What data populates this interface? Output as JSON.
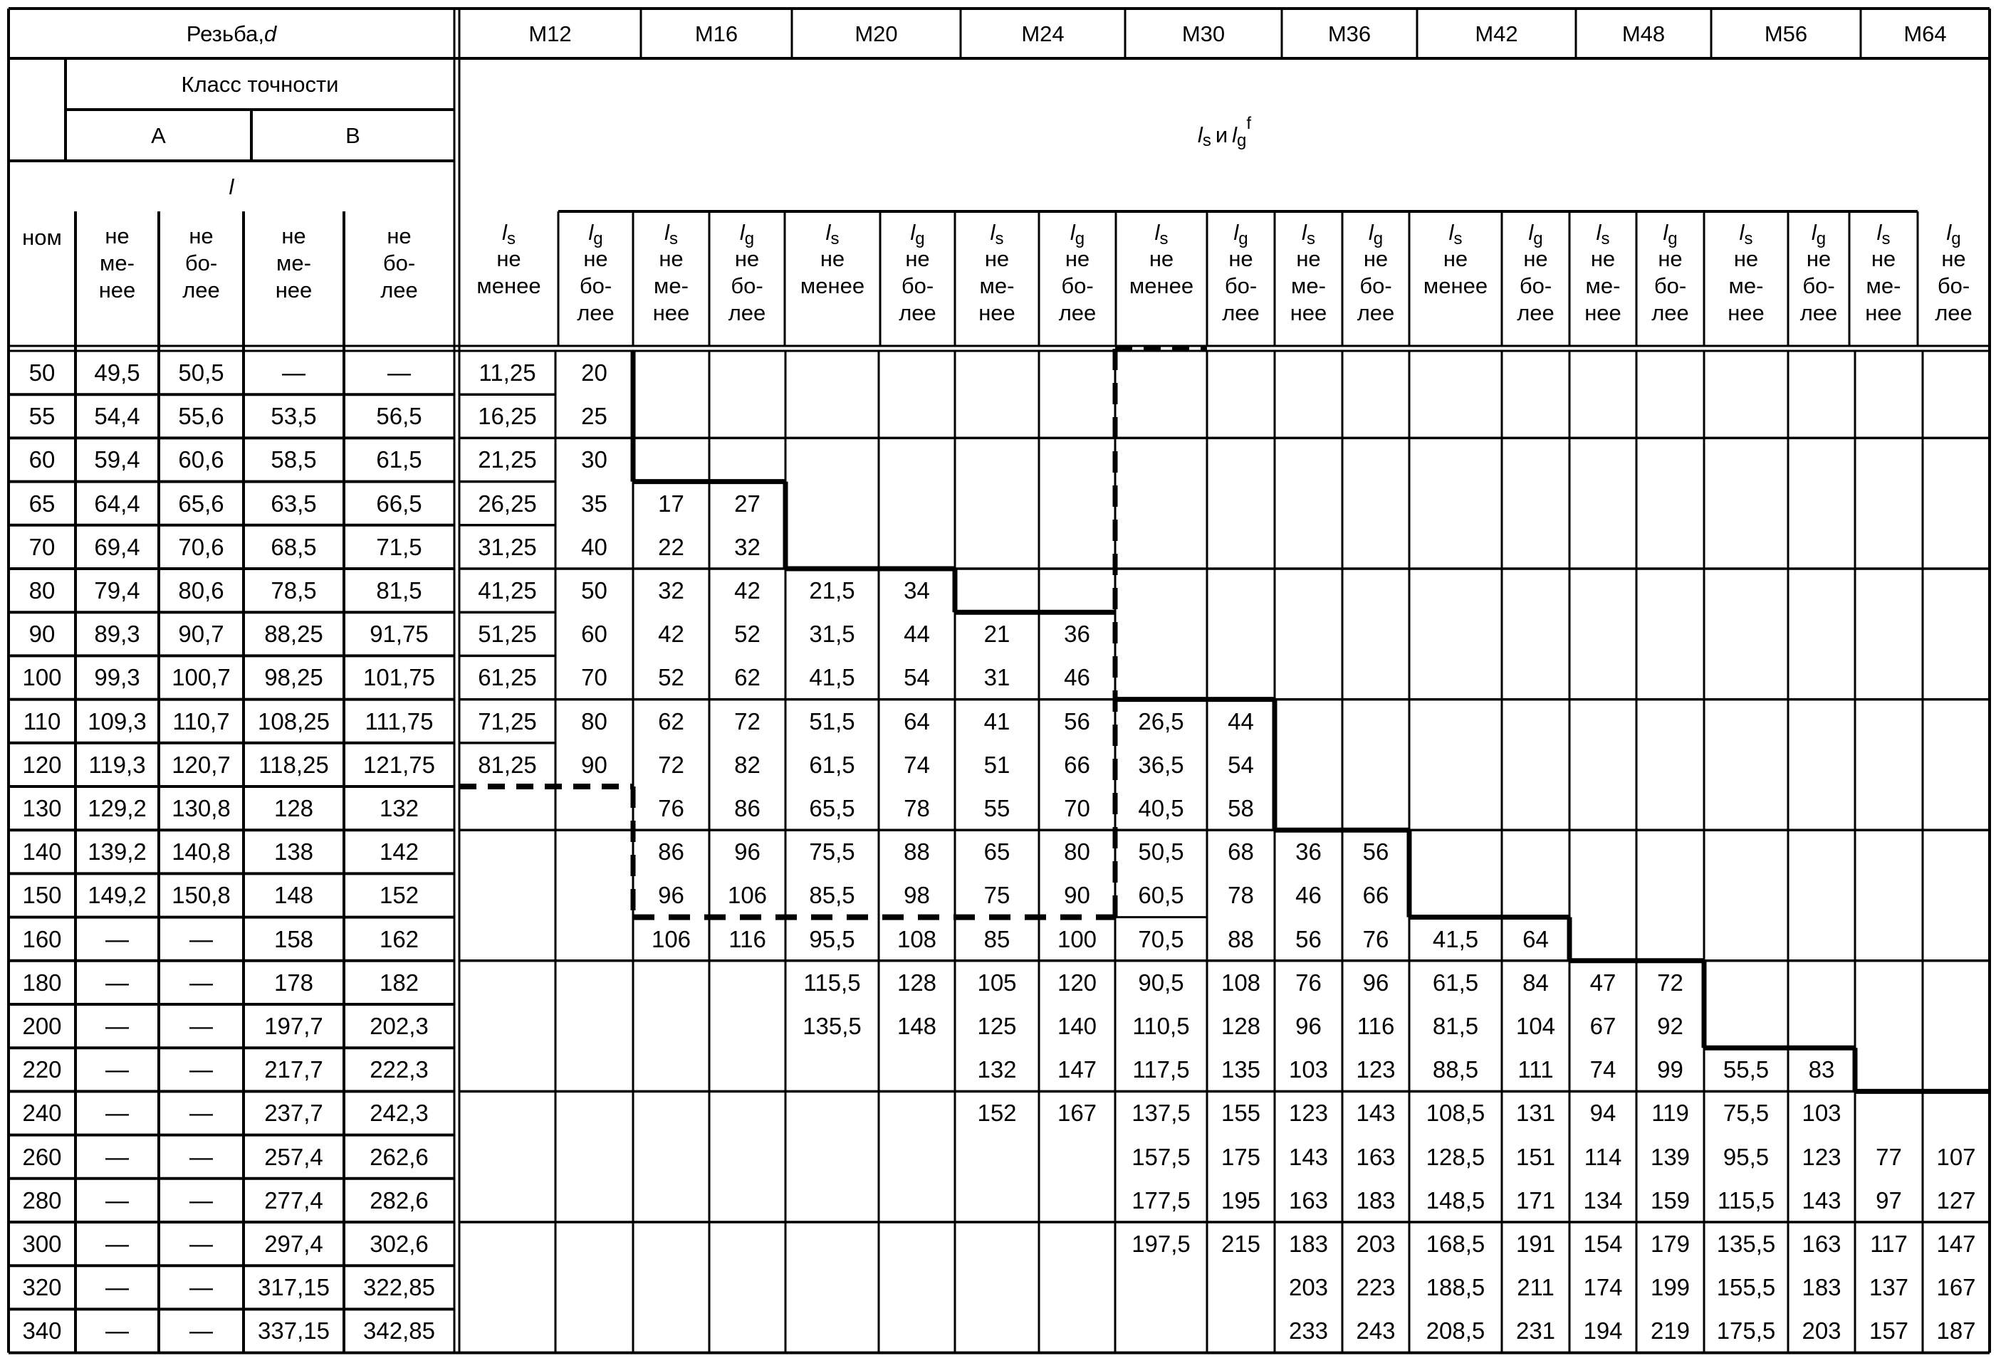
{
  "header": {
    "thread_label": "Резьба, ",
    "thread_symbol": "d",
    "accuracy_class": "Класс точности",
    "class_a": "A",
    "class_b": "B",
    "length_symbol": "l",
    "nominal": "ном",
    "ls_lg_label": {
      "ls": "l",
      "ls_sub": "s",
      "and": "и",
      "lg": "l",
      "lg_sub": "g",
      "lg_sup": "f"
    },
    "threads": [
      "M12",
      "M16",
      "M20",
      "M24",
      "M30",
      "M36",
      "M42",
      "M48",
      "M56",
      "M64"
    ],
    "limit_headers_left": [
      [
        "не",
        "ме-",
        "нее"
      ],
      [
        "не",
        "бо-",
        "лее"
      ],
      [
        "не",
        "ме-",
        "нее"
      ],
      [
        "не",
        "бо-",
        "лее"
      ]
    ],
    "sub_headers": [
      {
        "sym": "s",
        "lines": [
          "не",
          "менее"
        ]
      },
      {
        "sym": "g",
        "lines": [
          "не",
          "бо-",
          "лее"
        ]
      },
      {
        "sym": "s",
        "lines": [
          "не",
          "ме-",
          "нее"
        ]
      },
      {
        "sym": "g",
        "lines": [
          "не",
          "бо-",
          "лее"
        ]
      },
      {
        "sym": "s",
        "lines": [
          "не",
          "менее"
        ]
      },
      {
        "sym": "g",
        "lines": [
          "не",
          "бо-",
          "лее"
        ]
      },
      {
        "sym": "s",
        "lines": [
          "не",
          "ме-",
          "нее"
        ]
      },
      {
        "sym": "g",
        "lines": [
          "не",
          "бо-",
          "лее"
        ]
      },
      {
        "sym": "s",
        "lines": [
          "не",
          "менее"
        ]
      },
      {
        "sym": "g",
        "lines": [
          "не",
          "бо-",
          "лее"
        ]
      },
      {
        "sym": "s",
        "lines": [
          "не",
          "ме-",
          "нее"
        ]
      },
      {
        "sym": "g",
        "lines": [
          "не",
          "бо-",
          "лее"
        ]
      },
      {
        "sym": "s",
        "lines": [
          "не",
          "менее"
        ]
      },
      {
        "sym": "g",
        "lines": [
          "не",
          "бо-",
          "лее"
        ]
      },
      {
        "sym": "s",
        "lines": [
          "не",
          "ме-",
          "нее"
        ]
      },
      {
        "sym": "g",
        "lines": [
          "не",
          "бо-",
          "лее"
        ]
      },
      {
        "sym": "s",
        "lines": [
          "не",
          "ме-",
          "нее"
        ]
      },
      {
        "sym": "g",
        "lines": [
          "не",
          "бо-",
          "лее"
        ]
      },
      {
        "sym": "s",
        "lines": [
          "не",
          "ме-",
          "нее"
        ]
      },
      {
        "sym": "g",
        "lines": [
          "не",
          "бо-",
          "лее"
        ]
      }
    ]
  },
  "rows": [
    {
      "nom": "50",
      "a_min": "49,5",
      "a_max": "50,5",
      "b_min": "—",
      "b_max": "—",
      "v": [
        "11,25",
        "20",
        "",
        "",
        "",
        "",
        "",
        "",
        "",
        "",
        "",
        "",
        "",
        "",
        "",
        "",
        "",
        "",
        "",
        ""
      ]
    },
    {
      "nom": "55",
      "a_min": "54,4",
      "a_max": "55,6",
      "b_min": "53,5",
      "b_max": "56,5",
      "v": [
        "16,25",
        "25",
        "",
        "",
        "",
        "",
        "",
        "",
        "",
        "",
        "",
        "",
        "",
        "",
        "",
        "",
        "",
        "",
        "",
        ""
      ]
    },
    {
      "nom": "60",
      "a_min": "59,4",
      "a_max": "60,6",
      "b_min": "58,5",
      "b_max": "61,5",
      "v": [
        "21,25",
        "30",
        "",
        "",
        "",
        "",
        "",
        "",
        "",
        "",
        "",
        "",
        "",
        "",
        "",
        "",
        "",
        "",
        "",
        ""
      ]
    },
    {
      "nom": "65",
      "a_min": "64,4",
      "a_max": "65,6",
      "b_min": "63,5",
      "b_max": "66,5",
      "v": [
        "26,25",
        "35",
        "17",
        "27",
        "",
        "",
        "",
        "",
        "",
        "",
        "",
        "",
        "",
        "",
        "",
        "",
        "",
        "",
        "",
        ""
      ]
    },
    {
      "nom": "70",
      "a_min": "69,4",
      "a_max": "70,6",
      "b_min": "68,5",
      "b_max": "71,5",
      "v": [
        "31,25",
        "40",
        "22",
        "32",
        "",
        "",
        "",
        "",
        "",
        "",
        "",
        "",
        "",
        "",
        "",
        "",
        "",
        "",
        "",
        ""
      ]
    },
    {
      "nom": "80",
      "a_min": "79,4",
      "a_max": "80,6",
      "b_min": "78,5",
      "b_max": "81,5",
      "v": [
        "41,25",
        "50",
        "32",
        "42",
        "21,5",
        "34",
        "",
        "",
        "",
        "",
        "",
        "",
        "",
        "",
        "",
        "",
        "",
        "",
        "",
        ""
      ]
    },
    {
      "nom": "90",
      "a_min": "89,3",
      "a_max": "90,7",
      "b_min": "88,25",
      "b_max": "91,75",
      "v": [
        "51,25",
        "60",
        "42",
        "52",
        "31,5",
        "44",
        "21",
        "36",
        "",
        "",
        "",
        "",
        "",
        "",
        "",
        "",
        "",
        "",
        "",
        ""
      ]
    },
    {
      "nom": "100",
      "a_min": "99,3",
      "a_max": "100,7",
      "b_min": "98,25",
      "b_max": "101,75",
      "v": [
        "61,25",
        "70",
        "52",
        "62",
        "41,5",
        "54",
        "31",
        "46",
        "",
        "",
        "",
        "",
        "",
        "",
        "",
        "",
        "",
        "",
        "",
        ""
      ]
    },
    {
      "nom": "110",
      "a_min": "109,3",
      "a_max": "110,7",
      "b_min": "108,25",
      "b_max": "111,75",
      "v": [
        "71,25",
        "80",
        "62",
        "72",
        "51,5",
        "64",
        "41",
        "56",
        "26,5",
        "44",
        "",
        "",
        "",
        "",
        "",
        "",
        "",
        "",
        "",
        ""
      ]
    },
    {
      "nom": "120",
      "a_min": "119,3",
      "a_max": "120,7",
      "b_min": "118,25",
      "b_max": "121,75",
      "v": [
        "81,25",
        "90",
        "72",
        "82",
        "61,5",
        "74",
        "51",
        "66",
        "36,5",
        "54",
        "",
        "",
        "",
        "",
        "",
        "",
        "",
        "",
        "",
        ""
      ]
    },
    {
      "nom": "130",
      "a_min": "129,2",
      "a_max": "130,8",
      "b_min": "128",
      "b_max": "132",
      "v": [
        "",
        "",
        "76",
        "86",
        "65,5",
        "78",
        "55",
        "70",
        "40,5",
        "58",
        "",
        "",
        "",
        "",
        "",
        "",
        "",
        "",
        "",
        ""
      ]
    },
    {
      "nom": "140",
      "a_min": "139,2",
      "a_max": "140,8",
      "b_min": "138",
      "b_max": "142",
      "v": [
        "",
        "",
        "86",
        "96",
        "75,5",
        "88",
        "65",
        "80",
        "50,5",
        "68",
        "36",
        "56",
        "",
        "",
        "",
        "",
        "",
        "",
        "",
        ""
      ]
    },
    {
      "nom": "150",
      "a_min": "149,2",
      "a_max": "150,8",
      "b_min": "148",
      "b_max": "152",
      "v": [
        "",
        "",
        "96",
        "106",
        "85,5",
        "98",
        "75",
        "90",
        "60,5",
        "78",
        "46",
        "66",
        "",
        "",
        "",
        "",
        "",
        "",
        "",
        ""
      ]
    },
    {
      "nom": "160",
      "a_min": "—",
      "a_max": "—",
      "b_min": "158",
      "b_max": "162",
      "v": [
        "",
        "",
        "106",
        "116",
        "95,5",
        "108",
        "85",
        "100",
        "70,5",
        "88",
        "56",
        "76",
        "41,5",
        "64",
        "",
        "",
        "",
        "",
        "",
        ""
      ]
    },
    {
      "nom": "180",
      "a_min": "—",
      "a_max": "—",
      "b_min": "178",
      "b_max": "182",
      "v": [
        "",
        "",
        "",
        "",
        "115,5",
        "128",
        "105",
        "120",
        "90,5",
        "108",
        "76",
        "96",
        "61,5",
        "84",
        "47",
        "72",
        "",
        "",
        "",
        ""
      ]
    },
    {
      "nom": "200",
      "a_min": "—",
      "a_max": "—",
      "b_min": "197,7",
      "b_max": "202,3",
      "v": [
        "",
        "",
        "",
        "",
        "135,5",
        "148",
        "125",
        "140",
        "110,5",
        "128",
        "96",
        "116",
        "81,5",
        "104",
        "67",
        "92",
        "",
        "",
        "",
        ""
      ]
    },
    {
      "nom": "220",
      "a_min": "—",
      "a_max": "—",
      "b_min": "217,7",
      "b_max": "222,3",
      "v": [
        "",
        "",
        "",
        "",
        "",
        "",
        "132",
        "147",
        "117,5",
        "135",
        "103",
        "123",
        "88,5",
        "111",
        "74",
        "99",
        "55,5",
        "83",
        "",
        ""
      ]
    },
    {
      "nom": "240",
      "a_min": "—",
      "a_max": "—",
      "b_min": "237,7",
      "b_max": "242,3",
      "v": [
        "",
        "",
        "",
        "",
        "",
        "",
        "152",
        "167",
        "137,5",
        "155",
        "123",
        "143",
        "108,5",
        "131",
        "94",
        "119",
        "75,5",
        "103",
        "",
        ""
      ]
    },
    {
      "nom": "260",
      "a_min": "—",
      "a_max": "—",
      "b_min": "257,4",
      "b_max": "262,6",
      "v": [
        "",
        "",
        "",
        "",
        "",
        "",
        "",
        "",
        "157,5",
        "175",
        "143",
        "163",
        "128,5",
        "151",
        "114",
        "139",
        "95,5",
        "123",
        "77",
        "107"
      ]
    },
    {
      "nom": "280",
      "a_min": "—",
      "a_max": "—",
      "b_min": "277,4",
      "b_max": "282,6",
      "v": [
        "",
        "",
        "",
        "",
        "",
        "",
        "",
        "",
        "177,5",
        "195",
        "163",
        "183",
        "148,5",
        "171",
        "134",
        "159",
        "115,5",
        "143",
        "97",
        "127"
      ]
    },
    {
      "nom": "300",
      "a_min": "—",
      "a_max": "—",
      "b_min": "297,4",
      "b_max": "302,6",
      "v": [
        "",
        "",
        "",
        "",
        "",
        "",
        "",
        "",
        "197,5",
        "215",
        "183",
        "203",
        "168,5",
        "191",
        "154",
        "179",
        "135,5",
        "163",
        "117",
        "147"
      ]
    },
    {
      "nom": "320",
      "a_min": "—",
      "a_max": "—",
      "b_min": "317,15",
      "b_max": "322,85",
      "v": [
        "",
        "",
        "",
        "",
        "",
        "",
        "",
        "",
        "",
        "",
        "203",
        "223",
        "188,5",
        "211",
        "174",
        "199",
        "155,5",
        "183",
        "137",
        "167"
      ]
    },
    {
      "nom": "340",
      "a_min": "—",
      "a_max": "—",
      "b_min": "337,15",
      "b_max": "342,85",
      "v": [
        "",
        "",
        "",
        "",
        "",
        "",
        "",
        "",
        "",
        "",
        "233",
        "243",
        "208,5",
        "231",
        "194",
        "219",
        "175,5",
        "203",
        "157",
        "187"
      ]
    }
  ]
}
